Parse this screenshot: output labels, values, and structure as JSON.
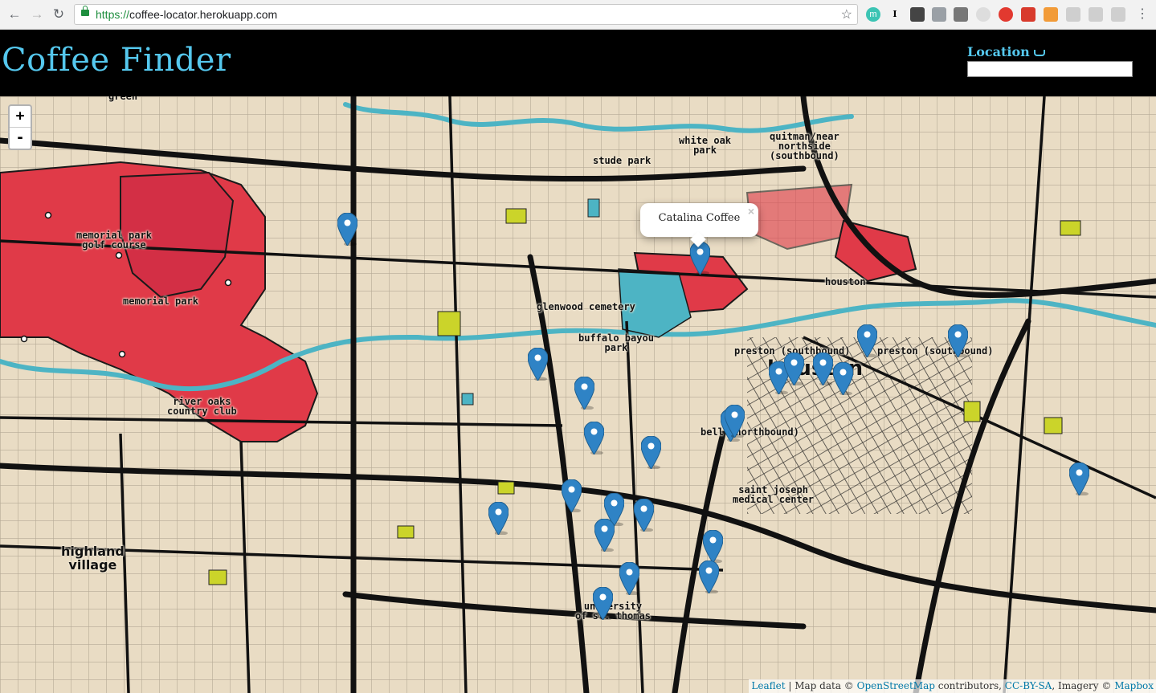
{
  "browser": {
    "url_protocol": "https://",
    "url_rest": "coffee-locator.herokuapp.com",
    "back_icon": "back-arrow-icon",
    "forward_icon": "forward-arrow-icon",
    "reload_icon": "reload-icon"
  },
  "header": {
    "title": "Coffee Finder",
    "location_label": "Location",
    "location_icon": "coffee-cup-icon",
    "location_value": ""
  },
  "map": {
    "zoom_in": "+",
    "zoom_out": "-",
    "labels": {
      "green": "green",
      "white_oak_park": "white oak\npark",
      "stude_park": "stude park",
      "quitman": "quitman/near\nnorthside\n(southbound)",
      "memorial_park_golf": "memorial park\ngolf course",
      "memorial_park": "memorial park",
      "glenwood_cemetery": "glenwood cemetery",
      "buffalo_bayou_park": "buffalo bayou\npark",
      "houston_station": "houston",
      "preston_1": "preston (southbound)",
      "preston_2": "preston (southbound)",
      "houston_big": "houston",
      "river_oaks": "river oaks\ncountry club",
      "bell": "bell (northbound)",
      "saint_joseph": "saint joseph\nmedical center",
      "highland_village": "highland\nvillage",
      "university_st_thomas": "university\nof st. thomas"
    },
    "popup": {
      "text": "Catalina Coffee",
      "close": "×"
    },
    "attribution": {
      "leaflet": "Leaflet",
      "sep": " | Map data © ",
      "osm": "OpenStreetMap",
      "contrib": " contributors, ",
      "license": "CC-BY-SA",
      "imagery": ", Imagery © ",
      "mapbox": "Mapbox"
    },
    "marker_color": "#2f83c5",
    "park_color": "#e03a48",
    "water_color": "#4db4c4"
  }
}
